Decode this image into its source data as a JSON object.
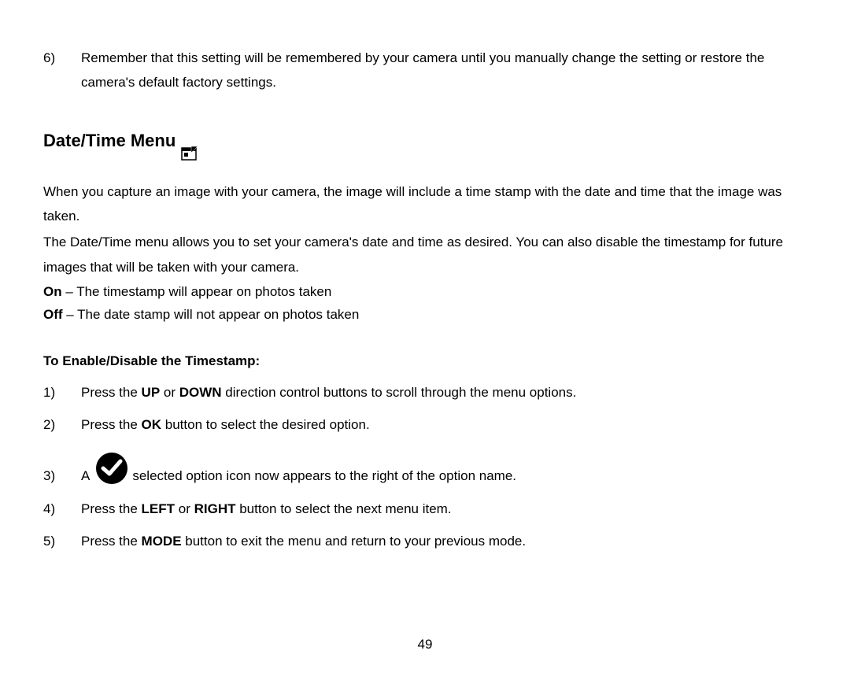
{
  "prior_item": {
    "num": "6)",
    "text": "Remember that this setting will be remembered by your camera until you manually change the setting or restore the camera's default factory settings."
  },
  "heading": "Date/Time Menu",
  "para1": "When you capture an image with your camera, the image will include a time stamp with the date and time that the image was taken.",
  "para2": "The Date/Time menu allows you to set your camera's date and time as desired. You can also disable the timestamp for future images that will be taken with your camera.",
  "on_label": "On",
  "on_text": " – The timestamp will appear on photos taken",
  "off_label": "Off",
  "off_text": " – The date stamp will not appear on photos taken",
  "sub_heading": "To Enable/Disable the Timestamp:",
  "steps": {
    "n1": "1)",
    "s1_a": "Press the ",
    "s1_b": "UP",
    "s1_c": " or ",
    "s1_d": "DOWN",
    "s1_e": " direction control buttons to scroll through the menu options.",
    "n2": "2)",
    "s2_a": "Press the ",
    "s2_b": "OK",
    "s2_c": " button to select the desired option.",
    "n3": "3)",
    "s3_a": "A",
    "s3_b": "selected option icon now appears to the right of the option name.",
    "n4": "4)",
    "s4_a": "Press the ",
    "s4_b": "LEFT",
    "s4_c": " or ",
    "s4_d": "RIGHT",
    "s4_e": " button to select the next menu item.",
    "n5": "5)",
    "s5_a": "Press the ",
    "s5_b": "MODE",
    "s5_c": " button to exit the menu and return to your previous mode."
  },
  "page_number": "49"
}
